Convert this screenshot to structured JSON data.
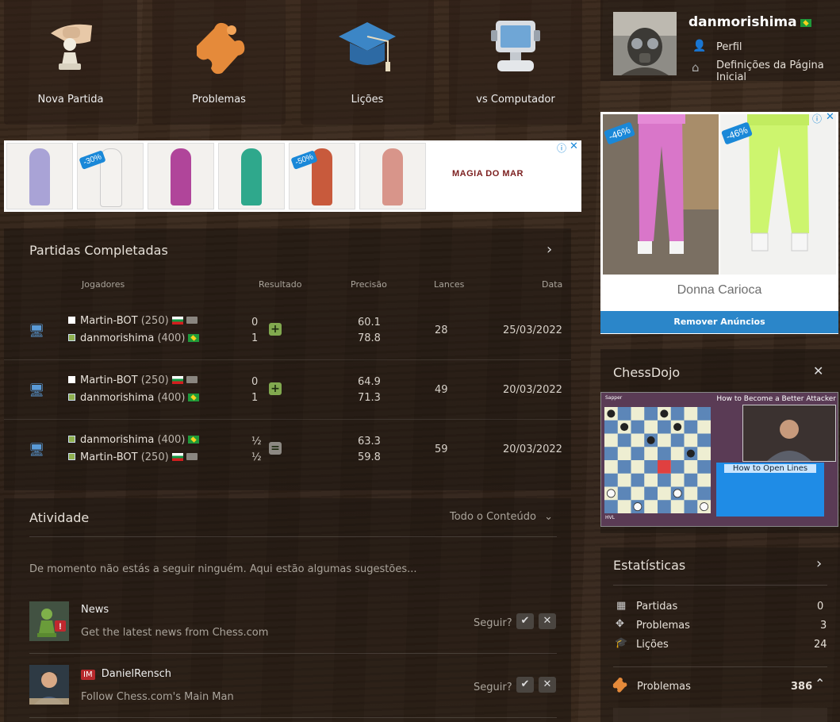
{
  "tiles": [
    {
      "label": "Nova Partida",
      "icon": "hand-pawn-icon"
    },
    {
      "label": "Problemas",
      "icon": "puzzle-icon"
    },
    {
      "label": "Lições",
      "icon": "graduation-cap-icon"
    },
    {
      "label": "vs Computador",
      "icon": "computer-icon"
    }
  ],
  "ad_top": {
    "badges": [
      "-30%",
      "-50%"
    ],
    "brand": "MAGIA DO MAR"
  },
  "completed": {
    "title": "Partidas Completadas",
    "headers": {
      "players": "Jogadores",
      "result": "Resultado",
      "accuracy": "Precisão",
      "moves": "Lances",
      "date": "Data"
    },
    "games": [
      {
        "p1": {
          "name": "Martin-BOT",
          "rating": "(250)",
          "color": "white"
        },
        "p2": {
          "name": "danmorishima",
          "rating": "(400)",
          "color": "green"
        },
        "scores": [
          "0",
          "1"
        ],
        "result_icon": "+",
        "acc": [
          "60.1",
          "78.8"
        ],
        "moves": "28",
        "date": "25/03/2022"
      },
      {
        "p1": {
          "name": "Martin-BOT",
          "rating": "(250)",
          "color": "white"
        },
        "p2": {
          "name": "danmorishima",
          "rating": "(400)",
          "color": "green"
        },
        "scores": [
          "0",
          "1"
        ],
        "result_icon": "+",
        "acc": [
          "64.9",
          "71.3"
        ],
        "moves": "49",
        "date": "20/03/2022"
      },
      {
        "p1": {
          "name": "danmorishima",
          "rating": "(400)",
          "color": "green"
        },
        "p2": {
          "name": "Martin-BOT",
          "rating": "(250)",
          "color": "green"
        },
        "scores": [
          "½",
          "½"
        ],
        "result_icon": "=",
        "acc": [
          "63.3",
          "59.8"
        ],
        "moves": "59",
        "date": "20/03/2022"
      }
    ]
  },
  "activity": {
    "title": "Atividade",
    "filter": "Todo o Conteúdo",
    "intro": "De momento não estás a seguir ninguém. Aqui estão algumas sugestões...",
    "suggestions": [
      {
        "name": "News",
        "desc": "Get the latest news from Chess.com",
        "follow": "Seguir?",
        "title_badge": ""
      },
      {
        "name": "DanielRensch",
        "desc": "Follow Chess.com's Main Man",
        "follow": "Seguir?",
        "title_badge": "IM"
      }
    ]
  },
  "user": {
    "username": "danmorishima",
    "links": [
      "Perfil",
      "Definições da Página Inicial"
    ]
  },
  "ad_side": {
    "badges": [
      "-46%",
      "-46%"
    ],
    "brand": "Donna Carioca",
    "remove": "Remover Anúncios"
  },
  "chessdojo": {
    "title": "ChessDojo",
    "video_title": "How to Become a Better Attacker",
    "card_title": "How to Open Lines",
    "player_top": "Sapper",
    "player_bottom": "HVL"
  },
  "stats": {
    "title": "Estatísticas",
    "rows": [
      {
        "label": "Partidas",
        "value": "0",
        "icon": "board-icon"
      },
      {
        "label": "Problemas",
        "value": "3",
        "icon": "puzzle-icon"
      },
      {
        "label": "Lições",
        "value": "24",
        "icon": "graduation-cap-icon"
      }
    ]
  },
  "problems_footer": {
    "label": "Problemas",
    "value": "386"
  }
}
